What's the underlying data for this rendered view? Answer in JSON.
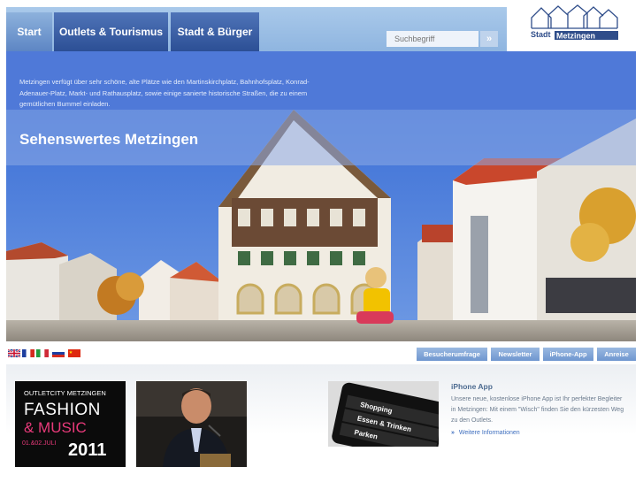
{
  "nav": {
    "tabs": [
      {
        "label": "Start"
      },
      {
        "label": "Outlets & Tourismus"
      },
      {
        "label": "Stadt & Bürger"
      }
    ],
    "search_placeholder": "Suchbegriff",
    "search_button_glyph": "»"
  },
  "logo": {
    "left": "Stadt",
    "right": "Metzingen"
  },
  "intro": {
    "text": "Metzingen verfügt über sehr schöne, alte Plätze wie den Martinskirchplatz, Bahnhofsplatz, Konrad-Adenauer-Platz, Markt- und Rathausplatz, sowie einige sanierte historische Straßen, die zu einem gemütlichen Bummel einladen."
  },
  "hero": {
    "title": "Sehenswertes Metzingen"
  },
  "languages": [
    "english-flag",
    "french-flag",
    "italian-flag",
    "russian-flag",
    "chinese-flag"
  ],
  "quick_links": [
    {
      "label": "Besucherumfrage"
    },
    {
      "label": "Newsletter"
    },
    {
      "label": "iPhone-App"
    },
    {
      "label": "Anreise"
    }
  ],
  "promos": {
    "fashion": {
      "line1": "OUTLETCITY METZINGEN",
      "line2": "FASHION",
      "line3": "& MUSIC",
      "dates": "01.&02.JULI",
      "year": "2011"
    },
    "iphone_screen": {
      "row1": "Shopping",
      "row2": "Essen & Trinken",
      "row3": "Parken"
    }
  },
  "iphone": {
    "title": "iPhone App",
    "text": "Unsere neue, kostenlose iPhone App ist Ihr perfekter Begleiter in Metzingen: Mit einem \"Wisch\" finden Sie den kürzesten Weg zu den Outlets.",
    "link": "Weitere Informationen",
    "link_glyph": "»"
  },
  "colors": {
    "accent": "#4f79d8",
    "nav_dark": "#2c4f95",
    "nav_light": "#a9c9ea",
    "text_link": "#3f6fbf"
  }
}
